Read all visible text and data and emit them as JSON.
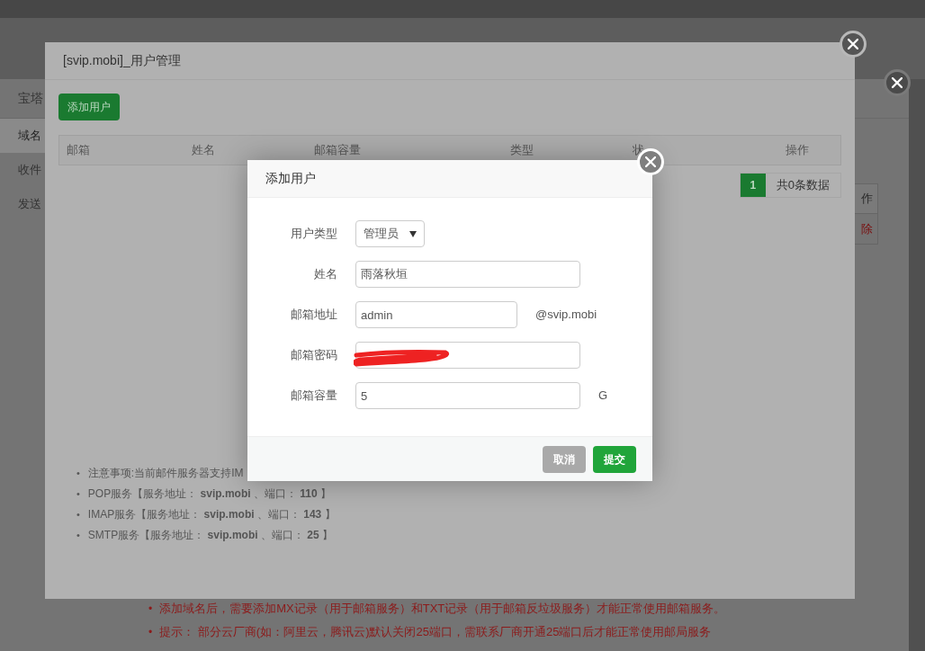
{
  "background_panel": {
    "title": "宝塔",
    "sidebar": {
      "items": [
        {
          "label": "域名",
          "selected": true
        },
        {
          "label": "收件",
          "selected": false
        },
        {
          "label": "发送",
          "selected": false
        }
      ]
    },
    "table": {
      "header": "作",
      "cell": "除"
    },
    "bullet": "•",
    "notes": [
      "添加域名后，需要添加MX记录（用于邮箱服务）和TXT记录（用于邮箱反垃圾服务）才能正常使用邮箱服务。",
      "提示： 部分云厂商(如：阿里云，腾讯云)默认关闭25端口，需联系厂商开通25端口后才能正常使用邮局服务"
    ]
  },
  "user_manager": {
    "title": "[svip.mobi]_用户管理",
    "add_button": "添加用户",
    "table": {
      "columns": [
        "邮箱",
        "姓名",
        "邮箱容量",
        "类型",
        "状",
        "操作"
      ]
    },
    "bullet": "•",
    "pagination": {
      "pages": [
        {
          "label": "1",
          "selected": true
        }
      ],
      "total": "共0条数据"
    },
    "notes": [
      "注意事项:当前邮件服务器支持IM",
      "POP服务【服务地址： **svip.mobi** 、端口： **110** 】",
      "IMAP服务【服务地址： **svip.mobi** 、端口： **143** 】",
      "SMTP服务【服务地址： **svip.mobi** 、端口： **25** 】"
    ]
  },
  "add_user_dialog": {
    "title": "添加用户",
    "fields": [
      {
        "kind": "select",
        "label": "用户类型",
        "value": "管理员"
      },
      {
        "kind": "text",
        "label": "姓名",
        "value": "雨落秋垣"
      },
      {
        "kind": "text",
        "label": "邮箱地址",
        "value": "admin",
        "suffix": "@svip.mobi"
      },
      {
        "kind": "password",
        "label": "邮箱密码",
        "redacted": true
      },
      {
        "kind": "text",
        "label": "邮箱容量",
        "value": "5",
        "suffix": "G"
      }
    ],
    "buttons": [
      {
        "kind": "cancel",
        "label": "取消"
      },
      {
        "kind": "submit",
        "label": "提交"
      }
    ]
  }
}
